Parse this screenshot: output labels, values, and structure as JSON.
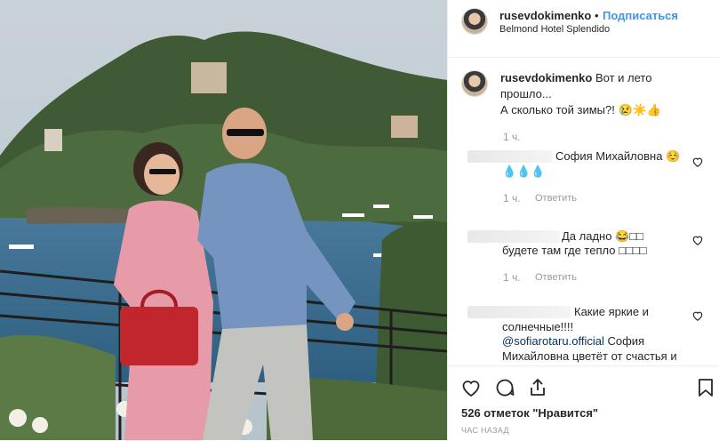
{
  "post": {
    "username": "rusevdokimenko",
    "follow_label": "Подписаться",
    "separator": "•",
    "location": "Belmond Hotel Splendido"
  },
  "comments": [
    {
      "username": "rusevdokimenko",
      "text_line1": "Вот и лето",
      "text_line2": "прошло...",
      "text_line3": "А сколько той зимы?! 😢☀️👍",
      "time": "1 ч."
    },
    {
      "text_line1": "София Михайловна ☺️",
      "text_line2": "💧💧💧",
      "time": "1 ч.",
      "reply_label": "Ответить"
    },
    {
      "text_line1": "Да ладно 😂□□",
      "text_line2": "будете там где тепло □□□□",
      "time": "1 ч.",
      "reply_label": "Ответить"
    },
    {
      "text_line1": "Какие яркие и",
      "text_line2": "солнечные!!!!",
      "mention": "@sofiarotaru.official",
      "text_line3": "София",
      "text_line4": "Михайловна цветёт от счастья и"
    }
  ],
  "footer": {
    "likes": "526 отметок \"Нравится\"",
    "time_ago": "ЧАС НАЗАД"
  },
  "icons": [
    "heart-icon",
    "comment-icon",
    "share-icon",
    "bookmark-icon"
  ]
}
